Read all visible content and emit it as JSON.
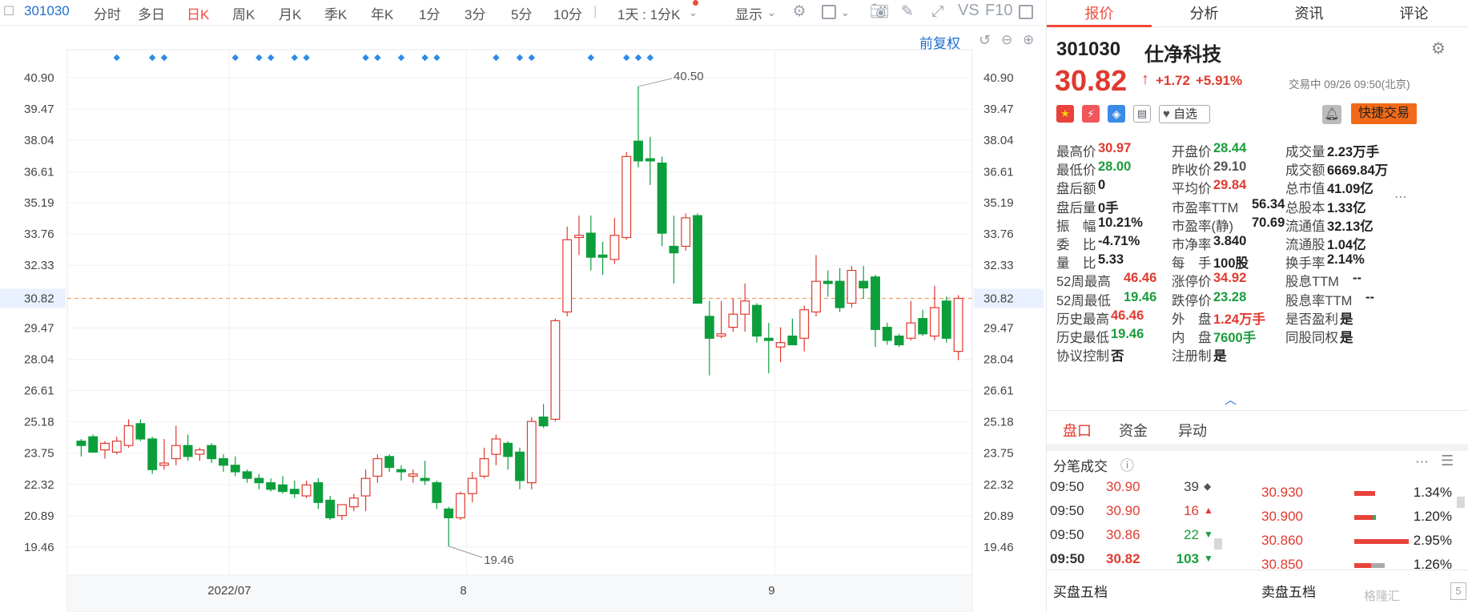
{
  "toolbar": {
    "code": "301030",
    "periods": [
      "分时",
      "多日",
      "日K",
      "周K",
      "月K",
      "季K",
      "年K",
      "1分",
      "3分",
      "5分",
      "10分"
    ],
    "active_period": "日K",
    "interval_select": "1天 : 1分K",
    "display": "显示",
    "vs_label": "VS",
    "f10_label": "F10",
    "icons": [
      "settings-icon",
      "square-icon",
      "camera-icon",
      "pen-icon",
      "fullscreen-icon",
      "sidebar-icon"
    ]
  },
  "chart": {
    "adjust_label": "前复权",
    "price_ticks": [
      "40.90",
      "39.47",
      "38.04",
      "36.61",
      "35.19",
      "33.76",
      "32.33",
      "30.82",
      "29.47",
      "28.04",
      "26.61",
      "25.18",
      "23.75",
      "22.32",
      "20.89",
      "19.46"
    ],
    "current_price_tag": "30.82",
    "high_label": "40.50",
    "low_label": "19.46",
    "x_labels": [
      "2022/07",
      "8",
      "9"
    ],
    "colors": {
      "up": "#e03a2f",
      "down": "#0d9e3c",
      "accent": "#f04a3a",
      "link": "#1f6fd1"
    }
  },
  "chart_data": {
    "type": "candlestick",
    "ylim": [
      19.46,
      40.9
    ],
    "low_marker": 19.46,
    "high_marker": 40.5,
    "current": 30.82,
    "candles": [
      {
        "o": 24.3,
        "h": 24.4,
        "l": 23.6,
        "c": 24.1
      },
      {
        "o": 24.5,
        "h": 24.6,
        "l": 24.0,
        "c": 23.8
      },
      {
        "o": 23.9,
        "h": 24.3,
        "l": 23.5,
        "c": 24.2
      },
      {
        "o": 23.8,
        "h": 24.5,
        "l": 23.7,
        "c": 24.3
      },
      {
        "o": 24.1,
        "h": 25.3,
        "l": 24.0,
        "c": 25.0
      },
      {
        "o": 25.1,
        "h": 25.3,
        "l": 24.3,
        "c": 24.4
      },
      {
        "o": 24.4,
        "h": 24.5,
        "l": 22.8,
        "c": 23.0
      },
      {
        "o": 23.2,
        "h": 24.4,
        "l": 23.0,
        "c": 23.3
      },
      {
        "o": 23.5,
        "h": 25.0,
        "l": 23.2,
        "c": 24.1
      },
      {
        "o": 24.1,
        "h": 24.6,
        "l": 23.4,
        "c": 23.6
      },
      {
        "o": 23.7,
        "h": 24.0,
        "l": 23.4,
        "c": 23.9
      },
      {
        "o": 24.1,
        "h": 24.2,
        "l": 23.3,
        "c": 23.5
      },
      {
        "o": 23.5,
        "h": 23.7,
        "l": 22.9,
        "c": 23.2
      },
      {
        "o": 23.2,
        "h": 23.6,
        "l": 22.7,
        "c": 22.9
      },
      {
        "o": 22.9,
        "h": 23.0,
        "l": 22.4,
        "c": 22.6
      },
      {
        "o": 22.6,
        "h": 22.8,
        "l": 22.1,
        "c": 22.4
      },
      {
        "o": 22.4,
        "h": 22.6,
        "l": 22.0,
        "c": 22.1
      },
      {
        "o": 22.3,
        "h": 22.7,
        "l": 21.9,
        "c": 22.0
      },
      {
        "o": 22.1,
        "h": 22.5,
        "l": 21.7,
        "c": 21.9
      },
      {
        "o": 21.8,
        "h": 22.5,
        "l": 21.7,
        "c": 22.3
      },
      {
        "o": 22.4,
        "h": 22.6,
        "l": 21.2,
        "c": 21.5
      },
      {
        "o": 21.6,
        "h": 21.8,
        "l": 20.7,
        "c": 20.8
      },
      {
        "o": 20.9,
        "h": 21.4,
        "l": 20.7,
        "c": 21.4
      },
      {
        "o": 21.3,
        "h": 21.9,
        "l": 21.1,
        "c": 21.7
      },
      {
        "o": 21.8,
        "h": 23.0,
        "l": 21.1,
        "c": 22.6
      },
      {
        "o": 22.7,
        "h": 23.7,
        "l": 22.4,
        "c": 23.5
      },
      {
        "o": 23.6,
        "h": 23.7,
        "l": 22.9,
        "c": 23.1
      },
      {
        "o": 23.0,
        "h": 23.2,
        "l": 22.5,
        "c": 22.9
      },
      {
        "o": 22.7,
        "h": 23.0,
        "l": 22.4,
        "c": 22.8
      },
      {
        "o": 22.6,
        "h": 23.4,
        "l": 22.3,
        "c": 22.5
      },
      {
        "o": 22.4,
        "h": 22.5,
        "l": 21.2,
        "c": 21.5
      },
      {
        "o": 21.2,
        "h": 21.3,
        "l": 19.5,
        "c": 20.8
      },
      {
        "o": 20.8,
        "h": 22.0,
        "l": 20.7,
        "c": 21.9
      },
      {
        "o": 21.9,
        "h": 22.9,
        "l": 21.5,
        "c": 22.6
      },
      {
        "o": 22.7,
        "h": 24.0,
        "l": 22.6,
        "c": 23.5
      },
      {
        "o": 23.7,
        "h": 24.6,
        "l": 23.2,
        "c": 24.4
      },
      {
        "o": 24.2,
        "h": 24.3,
        "l": 23.0,
        "c": 23.6
      },
      {
        "o": 23.8,
        "h": 24.0,
        "l": 22.1,
        "c": 22.5
      },
      {
        "o": 22.4,
        "h": 25.4,
        "l": 22.1,
        "c": 25.2
      },
      {
        "o": 25.4,
        "h": 26.0,
        "l": 24.9,
        "c": 25.0
      },
      {
        "o": 25.3,
        "h": 29.9,
        "l": 25.2,
        "c": 29.8
      },
      {
        "o": 30.2,
        "h": 34.1,
        "l": 30.0,
        "c": 33.5
      },
      {
        "o": 33.6,
        "h": 34.6,
        "l": 32.8,
        "c": 33.7
      },
      {
        "o": 33.8,
        "h": 34.6,
        "l": 32.1,
        "c": 32.7
      },
      {
        "o": 32.8,
        "h": 33.4,
        "l": 31.9,
        "c": 32.7
      },
      {
        "o": 32.6,
        "h": 34.5,
        "l": 32.4,
        "c": 33.7
      },
      {
        "o": 33.6,
        "h": 37.5,
        "l": 33.5,
        "c": 37.3
      },
      {
        "o": 38.0,
        "h": 40.5,
        "l": 36.8,
        "c": 37.1
      },
      {
        "o": 37.2,
        "h": 38.2,
        "l": 36.0,
        "c": 37.1
      },
      {
        "o": 37.0,
        "h": 37.3,
        "l": 33.2,
        "c": 33.8
      },
      {
        "o": 33.2,
        "h": 34.6,
        "l": 31.5,
        "c": 32.9
      },
      {
        "o": 33.2,
        "h": 34.7,
        "l": 33.0,
        "c": 34.5
      },
      {
        "o": 34.6,
        "h": 34.7,
        "l": 30.6,
        "c": 30.6
      },
      {
        "o": 30.0,
        "h": 30.7,
        "l": 27.3,
        "c": 29.0
      },
      {
        "o": 29.1,
        "h": 30.7,
        "l": 29.0,
        "c": 29.2
      },
      {
        "o": 29.5,
        "h": 30.8,
        "l": 29.3,
        "c": 30.1
      },
      {
        "o": 30.1,
        "h": 31.5,
        "l": 29.3,
        "c": 30.7
      },
      {
        "o": 30.5,
        "h": 30.6,
        "l": 28.8,
        "c": 29.1
      },
      {
        "o": 29.0,
        "h": 29.7,
        "l": 27.4,
        "c": 28.9
      },
      {
        "o": 28.6,
        "h": 29.5,
        "l": 27.9,
        "c": 28.8
      },
      {
        "o": 29.1,
        "h": 29.9,
        "l": 28.7,
        "c": 28.7
      },
      {
        "o": 29.0,
        "h": 30.5,
        "l": 28.4,
        "c": 30.3
      },
      {
        "o": 30.2,
        "h": 32.8,
        "l": 30.0,
        "c": 31.6
      },
      {
        "o": 31.6,
        "h": 32.1,
        "l": 30.9,
        "c": 31.5
      },
      {
        "o": 31.6,
        "h": 32.2,
        "l": 30.2,
        "c": 30.4
      },
      {
        "o": 30.6,
        "h": 32.3,
        "l": 30.4,
        "c": 32.1
      },
      {
        "o": 31.6,
        "h": 32.3,
        "l": 30.8,
        "c": 31.3
      },
      {
        "o": 31.8,
        "h": 31.9,
        "l": 28.6,
        "c": 29.4
      },
      {
        "o": 29.5,
        "h": 29.7,
        "l": 28.7,
        "c": 28.9
      },
      {
        "o": 29.1,
        "h": 29.2,
        "l": 28.6,
        "c": 28.7
      },
      {
        "o": 29.0,
        "h": 30.7,
        "l": 28.9,
        "c": 29.7
      },
      {
        "o": 29.9,
        "h": 30.3,
        "l": 29.1,
        "c": 29.2
      },
      {
        "o": 29.1,
        "h": 31.4,
        "l": 28.9,
        "c": 30.4
      },
      {
        "o": 30.7,
        "h": 30.9,
        "l": 28.8,
        "c": 29.0
      },
      {
        "o": 28.4,
        "h": 30.97,
        "l": 28.0,
        "c": 30.82
      }
    ],
    "markers": [
      3,
      6,
      7,
      13,
      15,
      16,
      18,
      19,
      24,
      25,
      27,
      29,
      30,
      35,
      37,
      38,
      43,
      46,
      47,
      48
    ]
  },
  "panel": {
    "tabs": [
      "报价",
      "分析",
      "资讯",
      "评论"
    ],
    "code": "301030",
    "name": "仕净科技",
    "price": "30.82",
    "change": "+1.72",
    "change_pct": "+5.91%",
    "status": "交易中 09/26 09:50(北京)",
    "watch_label": "自选",
    "trade_label": "快捷交易",
    "quotes": [
      [
        {
          "l": "最高价",
          "v": "30.97",
          "c": "red"
        },
        {
          "l": "开盘价",
          "v": "28.44",
          "c": "green"
        },
        {
          "l": "成交量",
          "v": "2.23万手",
          "c": "dark"
        }
      ],
      [
        {
          "l": "最低价",
          "v": "28.00",
          "c": "green"
        },
        {
          "l": "昨收价",
          "v": "29.10",
          "c": "gray"
        },
        {
          "l": "成交额",
          "v": "6669.84万",
          "c": "dark"
        }
      ],
      [
        {
          "l": "盘后额",
          "v": "0",
          "c": "dark"
        },
        {
          "l": "平均价",
          "v": "29.84",
          "c": "red"
        },
        {
          "l": "总市值",
          "v": "41.09亿",
          "c": "dark"
        }
      ],
      [
        {
          "l": "盘后量",
          "v": "0手",
          "c": "dark"
        },
        {
          "l": "市盈率TTM",
          "v": "56.34",
          "c": "dark"
        },
        {
          "l": "总股本",
          "v": "1.33亿",
          "c": "dark"
        }
      ],
      [
        {
          "l": "振　幅",
          "v": "10.21%",
          "c": "dark"
        },
        {
          "l": "市盈率(静)",
          "v": "70.69",
          "c": "dark"
        },
        {
          "l": "流通值",
          "v": "32.13亿",
          "c": "dark"
        }
      ],
      [
        {
          "l": "委　比",
          "v": "-4.71%",
          "c": "dark"
        },
        {
          "l": "市净率",
          "v": "3.840",
          "c": "dark"
        },
        {
          "l": "流通股",
          "v": "1.04亿",
          "c": "dark"
        }
      ],
      [
        {
          "l": "量　比",
          "v": "5.33",
          "c": "dark"
        },
        {
          "l": "每　手",
          "v": "100股",
          "c": "dark"
        },
        {
          "l": "换手率",
          "v": "2.14%",
          "c": "dark"
        }
      ],
      [
        {
          "l": "52周最高",
          "v": "46.46",
          "c": "red"
        },
        {
          "l": "涨停价",
          "v": "34.92",
          "c": "red"
        },
        {
          "l": "股息TTM",
          "v": "--",
          "c": "dark"
        }
      ],
      [
        {
          "l": "52周最低",
          "v": "19.46",
          "c": "green"
        },
        {
          "l": "跌停价",
          "v": "23.28",
          "c": "green"
        },
        {
          "l": "股息率TTM",
          "v": "--",
          "c": "dark"
        }
      ],
      [
        {
          "l": "历史最高",
          "v": "46.46",
          "c": "red"
        },
        {
          "l": "外　盘",
          "v": "1.24万手",
          "c": "red"
        },
        {
          "l": "是否盈利",
          "v": "是",
          "c": "dark"
        }
      ],
      [
        {
          "l": "历史最低",
          "v": "19.46",
          "c": "green"
        },
        {
          "l": "内　盘",
          "v": "7600手",
          "c": "green"
        },
        {
          "l": "同股同权",
          "v": "是",
          "c": "dark"
        }
      ],
      [
        {
          "l": "协议控制",
          "v": "否",
          "c": "dark"
        },
        {
          "l": "注册制",
          "v": "是",
          "c": "dark"
        },
        {
          "l": "",
          "v": "",
          "c": "dark"
        }
      ]
    ],
    "subtabs": [
      "盘口",
      "资金",
      "异动"
    ],
    "ticks_title": "分笔成交",
    "ticks": [
      {
        "t": "09:50",
        "p": "30.90",
        "v": "39",
        "d": "flat"
      },
      {
        "t": "09:50",
        "p": "30.90",
        "v": "16",
        "d": "up"
      },
      {
        "t": "09:50",
        "p": "30.86",
        "v": "22",
        "d": "down"
      },
      {
        "t": "09:50",
        "p": "30.82",
        "v": "103",
        "d": "down"
      }
    ],
    "dist": [
      {
        "p": "30.930",
        "pct": "1.34%",
        "r": 0.3,
        "g": 0
      },
      {
        "p": "30.900",
        "pct": "1.20%",
        "r": 0.27,
        "g": 0.05
      },
      {
        "p": "30.860",
        "pct": "2.95%",
        "r": 0.8,
        "g": 0
      },
      {
        "p": "30.850",
        "pct": "1.26%",
        "r": 0.25,
        "g": 0.2
      }
    ],
    "buy5": "买盘五档",
    "sell5": "卖盘五档",
    "watermark": "格隆汇"
  }
}
